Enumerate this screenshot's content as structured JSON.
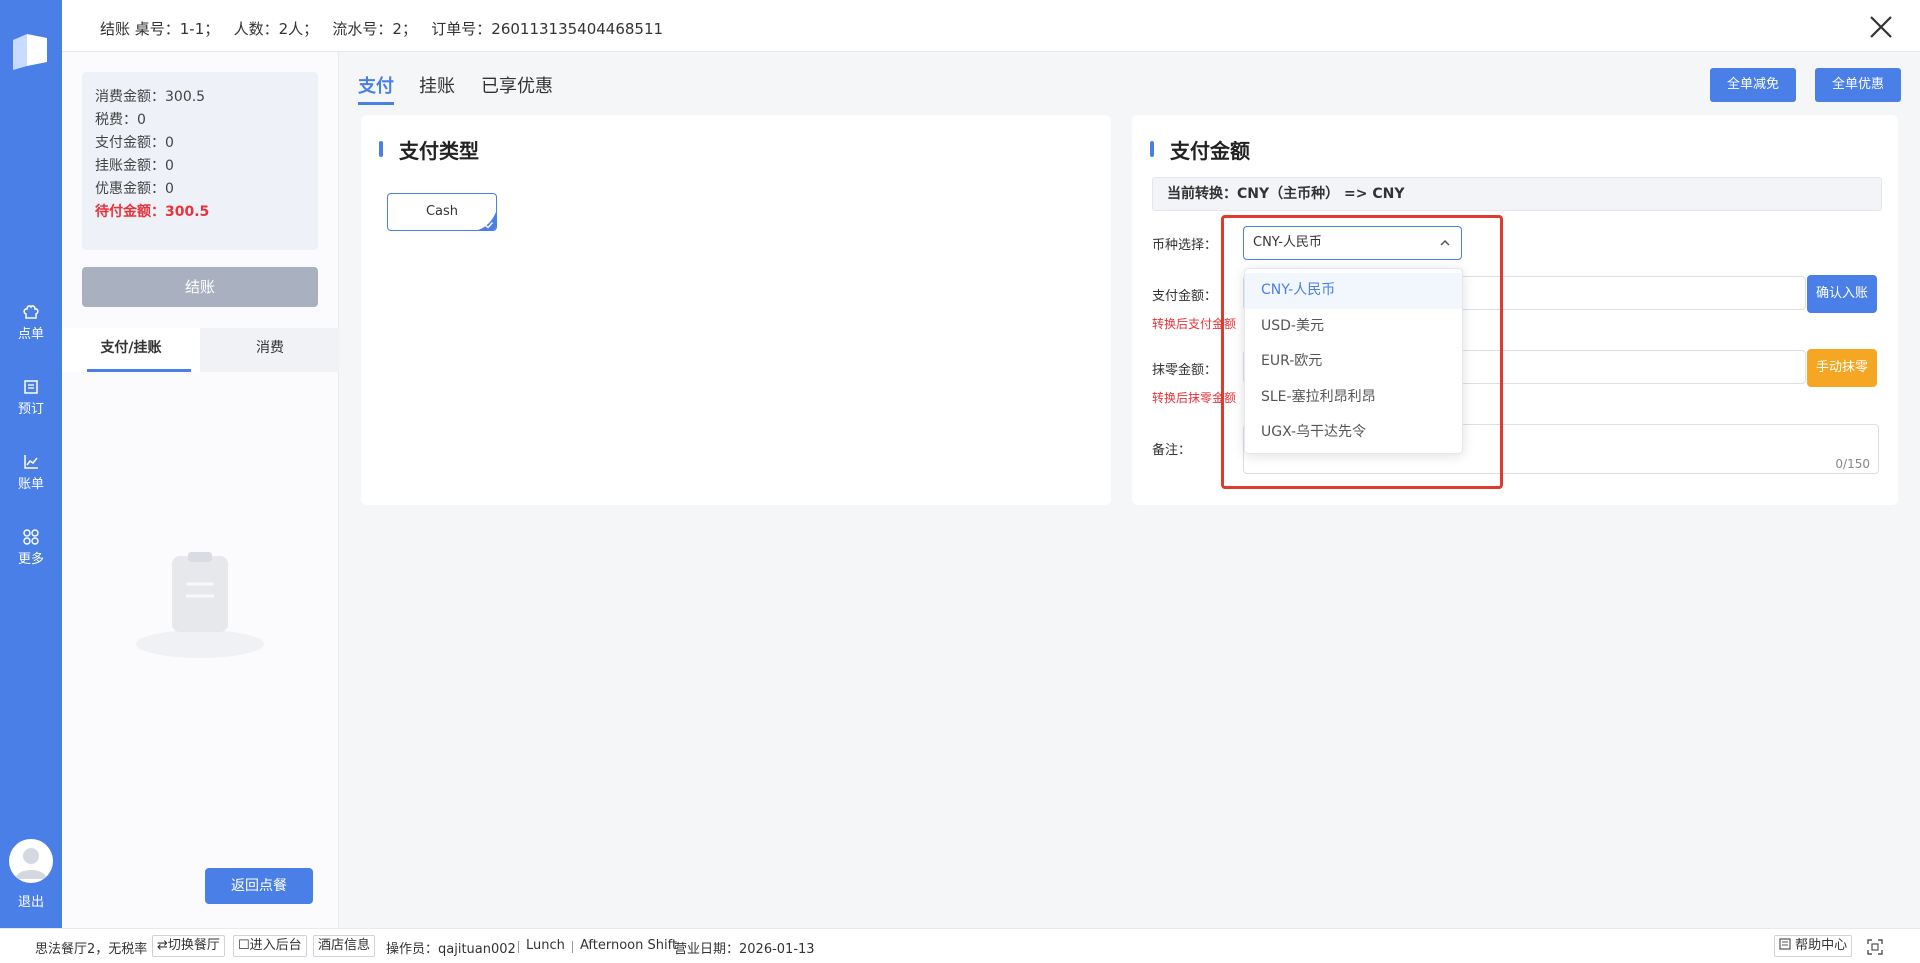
{
  "header": {
    "info": "结账 桌号：1-1；   人数：2人；   流水号：2；   订单号：260113135404468511"
  },
  "nav": {
    "items": [
      {
        "label": "点单",
        "icon": "chef-hat-icon"
      },
      {
        "label": "预订",
        "icon": "book-icon"
      },
      {
        "label": "账单",
        "icon": "chart-icon"
      },
      {
        "label": "更多",
        "icon": "grid-icon"
      }
    ],
    "logout": "退出"
  },
  "summary": {
    "consumption": "消费金额：300.5",
    "tax": "税费：0",
    "paid": "支付金额：0",
    "on_account": "挂账金额：0",
    "discount": "优惠金额：0",
    "due": "待付金额：300.5"
  },
  "side": {
    "checkout": "结账",
    "tabs": [
      "支付/挂账",
      "消费"
    ],
    "back": "返回点餐"
  },
  "main": {
    "tabs": [
      "支付",
      "挂账",
      "已享优惠"
    ],
    "btn_reduce": "全单减免",
    "btn_discount": "全单优惠"
  },
  "paytype": {
    "title": "支付类型",
    "option": "Cash"
  },
  "payamount": {
    "title": "支付金额",
    "conversion": "当前转换：CNY（主币种） => CNY",
    "currency_label": "币种选择：",
    "currency_value": "CNY-人民币",
    "amount_label": "支付金额：",
    "amount_hint": "转换后支付金额",
    "rounding_label": "抹零金额：",
    "rounding_hint": "转换后抹零金额",
    "note_label": "备注：",
    "note_count": "0/150",
    "confirm_btn": "确认入账",
    "rounding_btn": "手动抹零"
  },
  "dropdown": {
    "options": [
      "CNY-人民币",
      "USD-美元",
      "EUR-欧元",
      "SLE-塞拉利昂利昂",
      "UGX-乌干达先令"
    ]
  },
  "footer": {
    "restaurant": "思法餐厅2，无税率",
    "switch": "⇄切换餐厅",
    "backend": "☐进入后台",
    "hotel": "酒店信息",
    "operator": "操作员：qajituan002",
    "meal": "Lunch",
    "shift": "Afternoon Shift",
    "biz_date": "营业日期：2026-01-13",
    "help": "帮助中心"
  },
  "colors": {
    "primary": "#4a7fe8",
    "danger": "#e8333a",
    "orange": "#f5a623",
    "highlight": "#e03a2f"
  }
}
